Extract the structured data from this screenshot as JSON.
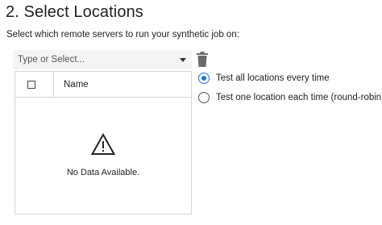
{
  "section": {
    "title": "2. Select Locations",
    "subtitle": "Select which remote servers to run your synthetic job on:"
  },
  "location_select": {
    "placeholder": "Type or Select...",
    "caret_icon": "caret-down-icon",
    "delete_icon": "trash-icon"
  },
  "table": {
    "columns": [
      "",
      "Name"
    ],
    "empty_icon": "warning-triangle-icon",
    "empty_message": "No Data Available."
  },
  "run_mode": {
    "options": [
      {
        "label": "Test all locations every time",
        "selected": true
      },
      {
        "label": "Test one location each time (round-robin)",
        "selected": false
      }
    ],
    "accent_color": "#1a73e8"
  }
}
